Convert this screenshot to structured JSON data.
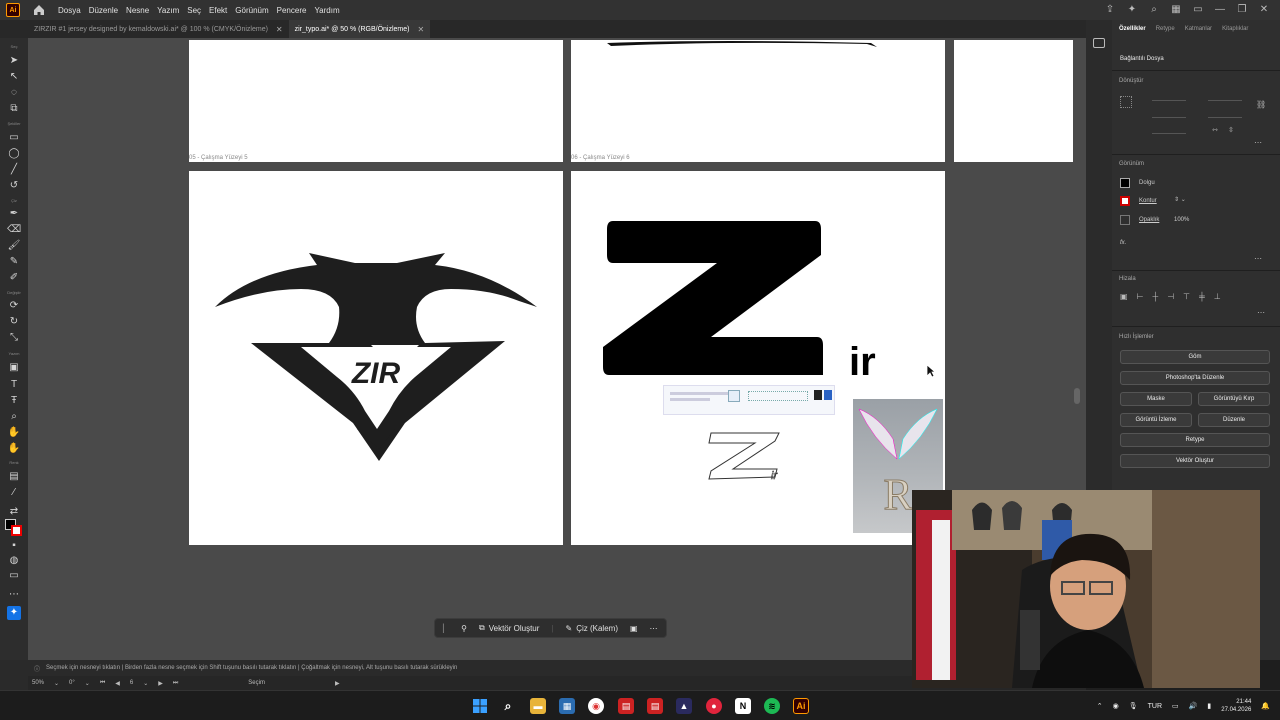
{
  "app": {
    "logo": "Ai"
  },
  "menu": [
    "Dosya",
    "Düzenle",
    "Nesne",
    "Yazım",
    "Seç",
    "Efekt",
    "Görünüm",
    "Pencere",
    "Yardım"
  ],
  "tabs": [
    {
      "label": "ZIRZIR #1 jersey designed by kemaldowski.ai* @ 100 % (CMYK/Önizleme)",
      "active": false
    },
    {
      "label": "zir_typo.ai* @ 50 % (RGB/Önizleme)",
      "active": true
    }
  ],
  "tool_labels": {
    "select": "Seç",
    "shapes": "Şekiller",
    "draw": "Çiz",
    "modify": "Değiştir",
    "type": "Yazım",
    "color": "Renk"
  },
  "artboards": {
    "a5": "05 - Çalışma Yüzeyi 5",
    "a6": "06 - Çalışma Yüzeyi 6"
  },
  "logo_text": {
    "zir": "ZIR",
    "z": "Z",
    "ir": "ir",
    "paint_z": "Z",
    "paint_ir": "ir"
  },
  "panel": {
    "tabs": [
      "Özellikler",
      "Retype",
      "Katmanlar",
      "Kitaplıklar"
    ],
    "linked_file": "Bağlantılı Dosya",
    "transform": "Dönüştür",
    "appearance": "Görünüm",
    "fill": "Dolgu",
    "stroke": "Kontur",
    "opacity": "Opaklık",
    "opacity_value": "100%",
    "fx": "fx.",
    "align": "Hizala",
    "quick_actions": "Hızlı İşlemler",
    "buttons": {
      "embed": "Göm",
      "photoshop": "Photoshop'ta Düzenle",
      "mask": "Maske",
      "crop": "Görüntüyü Kırp",
      "trace": "Görüntü İzleme",
      "edit": "Düzenle",
      "retype": "Retype",
      "vectorize": "Vektör Oluştur"
    }
  },
  "context_toolbar": {
    "vectorize": "Vektör Oluştur",
    "draw": "Çiz (Kalem)"
  },
  "hint": "Seçmek için nesneyi tıklatın  |  Birden fazla nesne seçmek için Shift tuşunu basılı tutarak tıklatın  |  Çoğaltmak için nesneyi, Alt tuşunu basılı tutarak sürükleyin",
  "status": {
    "zoom": "50%",
    "rotate": "0°",
    "artboard": "6",
    "mode": "Seçim"
  },
  "tray": {
    "lang": "TUR",
    "time": "21:44",
    "date": "27.04.2026"
  }
}
